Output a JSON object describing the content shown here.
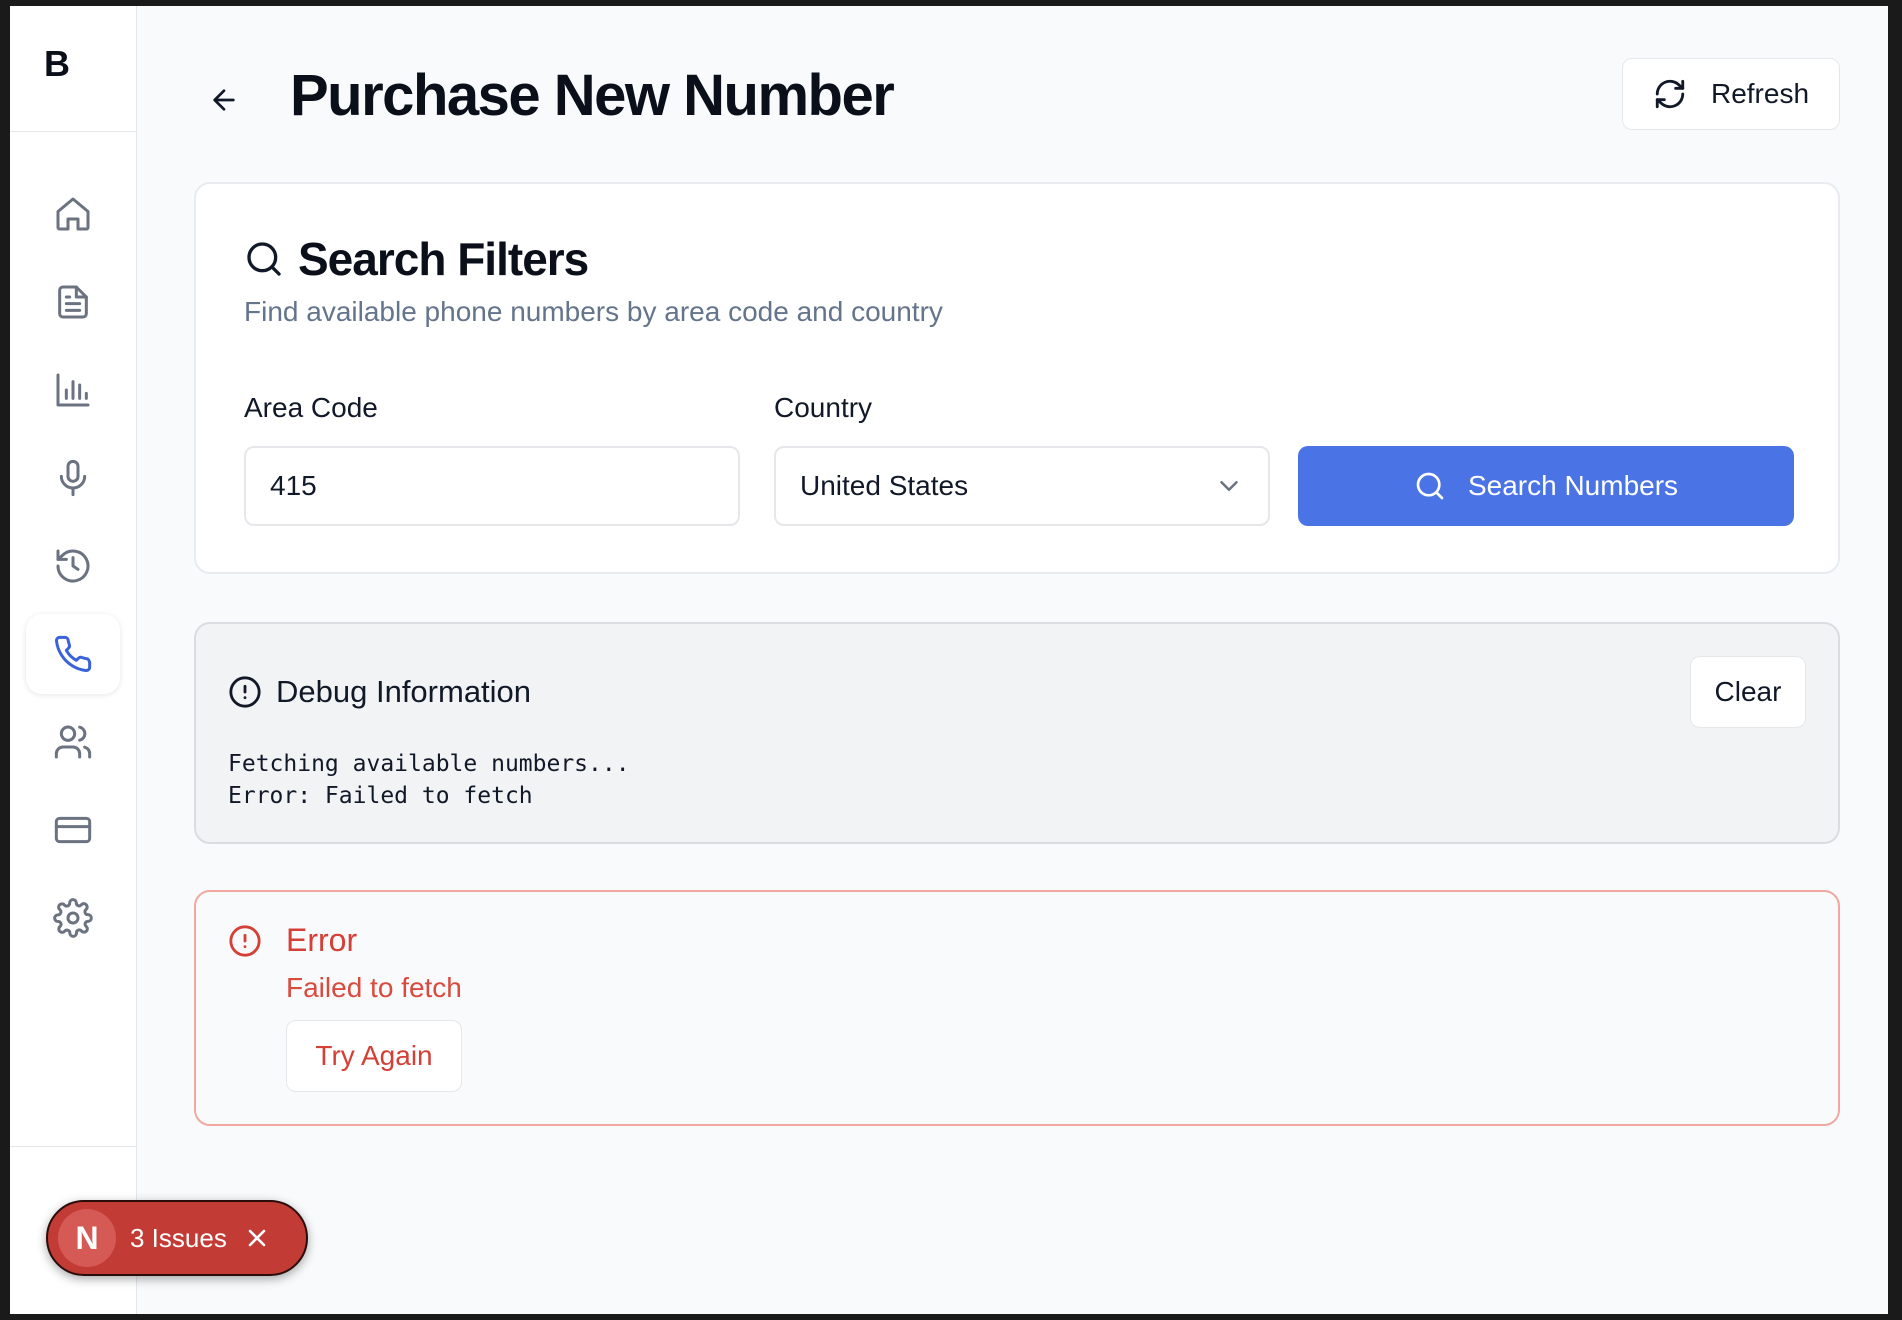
{
  "app": {
    "brand": "B"
  },
  "sidebar": {
    "items": [
      {
        "icon": "home-icon",
        "active": false
      },
      {
        "icon": "document-icon",
        "active": false
      },
      {
        "icon": "bar-chart-icon",
        "active": false
      },
      {
        "icon": "microphone-icon",
        "active": false
      },
      {
        "icon": "history-icon",
        "active": false
      },
      {
        "icon": "phone-icon",
        "active": true
      },
      {
        "icon": "users-icon",
        "active": false
      },
      {
        "icon": "credit-card-icon",
        "active": false
      },
      {
        "icon": "settings-icon",
        "active": false
      }
    ]
  },
  "header": {
    "title": "Purchase New Number",
    "refresh_label": "Refresh"
  },
  "filters": {
    "title": "Search Filters",
    "subtitle": "Find available phone numbers by area code and country",
    "area_code_label": "Area Code",
    "area_code_value": "415",
    "country_label": "Country",
    "country_value": "United States",
    "search_label": "Search Numbers"
  },
  "debug": {
    "title": "Debug Information",
    "clear_label": "Clear",
    "log": "Fetching available numbers...\nError: Failed to fetch"
  },
  "error": {
    "title": "Error",
    "message": "Failed to fetch",
    "retry_label": "Try Again"
  },
  "issues": {
    "logo": "N",
    "label": "3 Issues"
  },
  "colors": {
    "accent": "#4a74e6",
    "active_nav": "#3b63d9",
    "error": "#d43f36",
    "issues_bg": "#c23b35"
  }
}
